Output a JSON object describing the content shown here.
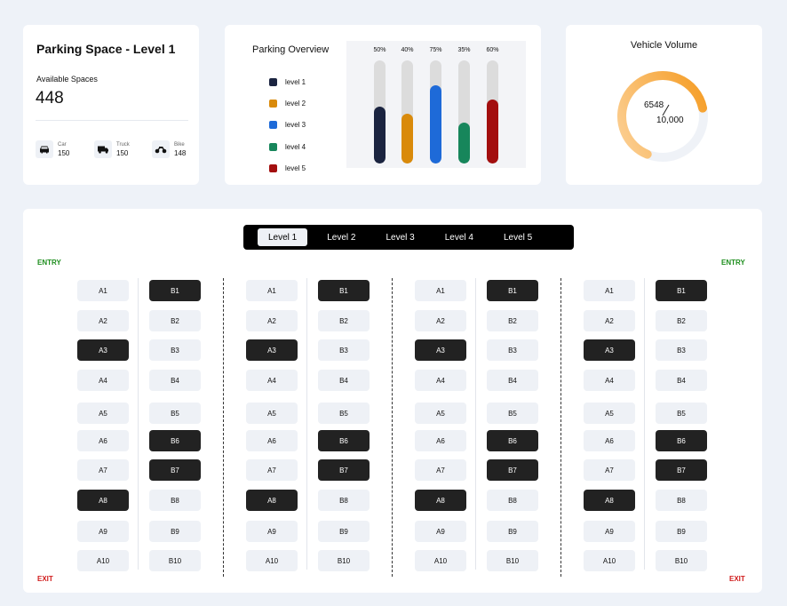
{
  "space": {
    "title": "Parking Space -  Level 1",
    "available_label": "Available Spaces",
    "available_value": "448",
    "vehicles": [
      {
        "label": "Car",
        "count": "150",
        "icon": "car-icon"
      },
      {
        "label": "Truck",
        "count": "150",
        "icon": "truck-icon"
      },
      {
        "label": "Bike",
        "count": "148",
        "icon": "bike-icon"
      }
    ]
  },
  "overview": {
    "title": "Parking Overview",
    "legend": [
      {
        "label": "level 1",
        "color": "#1b2440"
      },
      {
        "label": "level 2",
        "color": "#d98a0b"
      },
      {
        "label": "level 3",
        "color": "#1e6ad8"
      },
      {
        "label": "level 4",
        "color": "#17865b"
      },
      {
        "label": "level 5",
        "color": "#a30f0f"
      }
    ],
    "bars": [
      {
        "pct_label": "50%",
        "value": 0.55
      },
      {
        "pct_label": "40%",
        "value": 0.48
      },
      {
        "pct_label": "75%",
        "value": 0.76
      },
      {
        "pct_label": "35%",
        "value": 0.4
      },
      {
        "pct_label": "60%",
        "value": 0.62
      }
    ]
  },
  "volume": {
    "title": "Vehicle  Volume",
    "value": "6548",
    "total": "10,000",
    "fraction": 0.6548,
    "ring_color_start": "#f59a1f",
    "ring_color_end": "#fcd29a",
    "track_color": "#eff2f7"
  },
  "lot": {
    "levels": [
      "Level 1",
      "Level 2",
      "Level 3",
      "Level 4",
      "Level 5"
    ],
    "active_level": 0,
    "entry_label": "ENTRY",
    "exit_label": "EXIT",
    "a_slots": [
      "A1",
      "A2",
      "A3",
      "A4",
      "A5",
      "A6",
      "A7",
      "A8",
      "A9",
      "A10"
    ],
    "b_slots": [
      "B1",
      "B2",
      "B3",
      "B4",
      "B5",
      "B6",
      "B7",
      "B8",
      "B9",
      "B10"
    ],
    "a_occupied": [
      2,
      7
    ],
    "b_occupied": [
      0,
      5,
      6
    ],
    "blocks": 4
  }
}
